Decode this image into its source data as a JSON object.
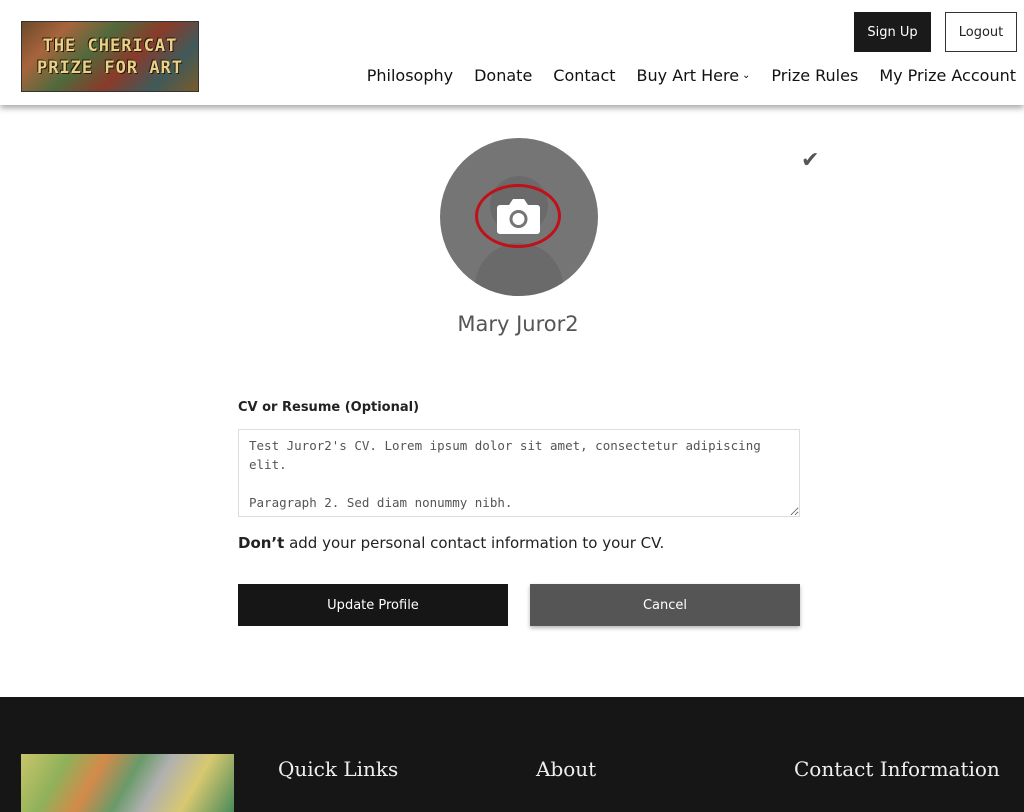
{
  "header": {
    "logo_text_1": "THE CHERICAT",
    "logo_text_2": "PRIZE FOR ART",
    "signup_label": "Sign Up",
    "logout_label": "Logout",
    "nav": [
      "Philosophy",
      "Donate",
      "Contact",
      "Buy Art Here",
      "Prize Rules",
      "My Prize Account"
    ]
  },
  "profile": {
    "name": "Mary Juror2",
    "cv_label": "CV or Resume (Optional)",
    "cv_text": "Test Juror2's CV. Lorem ipsum dolor sit amet, consectetur adipiscing elit.\n\nParagraph 2. Sed diam nonummy nibh.",
    "note_bold": "Don’t",
    "note_rest": " add your personal contact information to your CV.",
    "update_label": "Update Profile",
    "cancel_label": "Cancel"
  },
  "footer": {
    "quick_links": "Quick Links",
    "about": "About",
    "contact_info": "Contact Information"
  },
  "colors": {
    "accent_red": "#c0101a",
    "dark": "#161616",
    "footer_link": "#d98a2a"
  }
}
